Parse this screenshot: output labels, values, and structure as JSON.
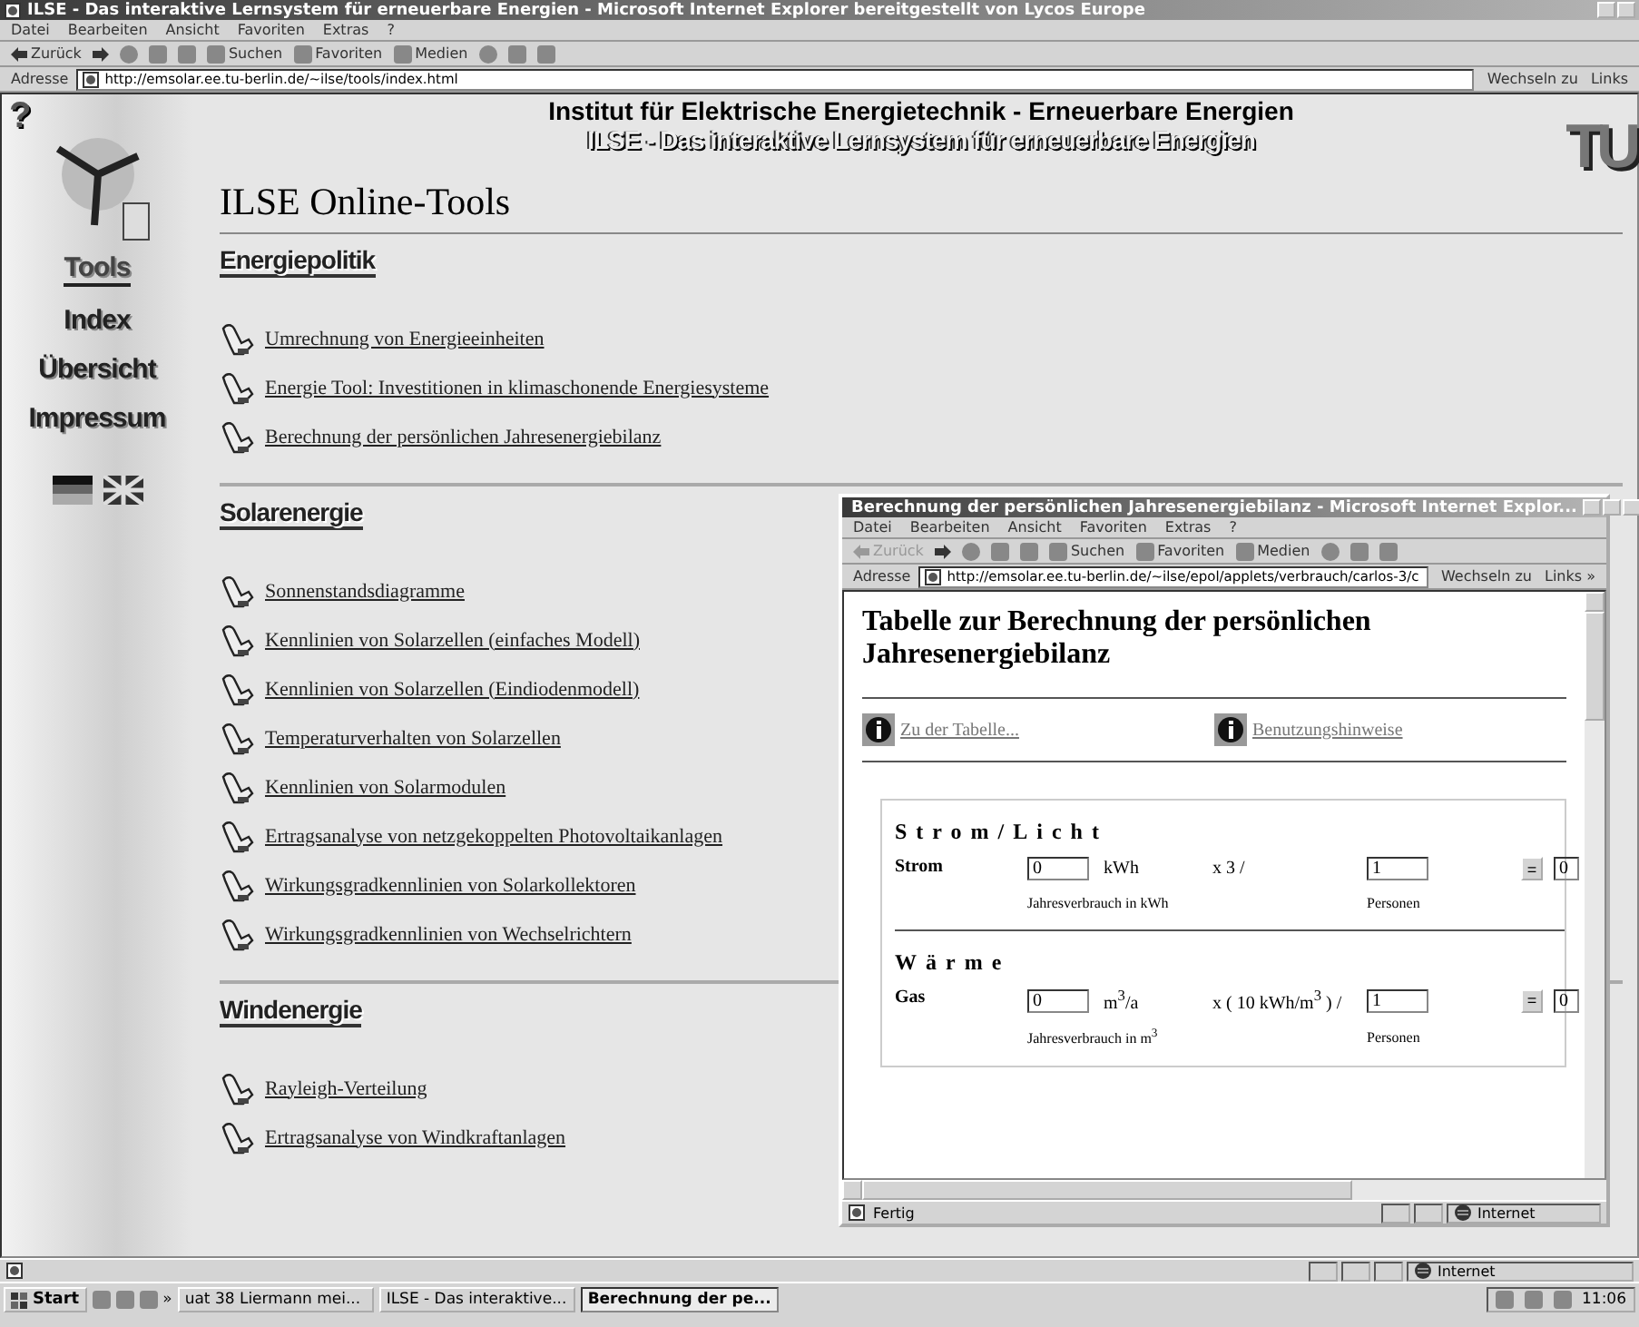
{
  "window": {
    "title": "ILSE - Das interaktive Lernsystem für erneuerbare Energien - Microsoft Internet Explorer bereitgestellt von Lycos Europe",
    "menu": [
      "Datei",
      "Bearbeiten",
      "Ansicht",
      "Favoriten",
      "Extras",
      "?"
    ],
    "toolbar": {
      "back": {
        "label": "Zurück",
        "disabled": false
      },
      "buttons": [
        "Suchen",
        "Favoriten",
        "Medien"
      ]
    },
    "address": {
      "label": "Adresse",
      "value": "http://emsolar.ee.tu-berlin.de/~ilse/tools/index.html"
    },
    "go": "Wechseln zu",
    "links": "Links"
  },
  "page": {
    "help": "?",
    "logo": "TU",
    "header_title": "Institut für Elektrische Energietechnik - Erneuerbare Energien",
    "header_subtitle": "ILSE - Das interaktive Lernsystem für erneuerbare Energien",
    "sidebar": [
      {
        "label": "Tools",
        "selected": true
      },
      {
        "label": "Index",
        "selected": false
      },
      {
        "label": "Übersicht",
        "selected": false
      },
      {
        "label": "Impressum",
        "selected": false
      }
    ],
    "heading": "ILSE Online-Tools",
    "sections": [
      {
        "title": "Energiepolitik",
        "links": [
          "Umrechnung von Energieeinheiten",
          "Energie Tool: Investitionen in klimaschonende Energiesysteme",
          "Berechnung der persönlichen Jahresenergiebilanz"
        ]
      },
      {
        "title": "Solarenergie",
        "links": [
          "Sonnenstandsdiagramme",
          "Kennlinien von Solarzellen (einfaches Modell)",
          "Kennlinien von Solarzellen (Eindiodenmodell)",
          "Temperaturverhalten von Solarzellen",
          "Kennlinien von Solarmodulen",
          "Ertragsanalyse von netzgekoppelten Photovoltaikanlagen",
          "Wirkungsgradkennlinien von Solarkollektoren",
          "Wirkungsgradkennlinien von Wechselrichtern"
        ]
      },
      {
        "title": "Windenergie",
        "links": [
          "Rayleigh-Verteilung",
          "Ertragsanalyse von Windkraftanlagen"
        ]
      }
    ]
  },
  "popup": {
    "title": "Berechnung der persönlichen Jahresenergiebilanz - Microsoft Internet Explor...",
    "menu": [
      "Datei",
      "Bearbeiten",
      "Ansicht",
      "Favoriten",
      "Extras",
      "?"
    ],
    "toolbar": {
      "back": {
        "label": "Zurück",
        "disabled": true
      },
      "buttons": [
        "Suchen",
        "Favoriten",
        "Medien"
      ]
    },
    "address": {
      "label": "Adresse",
      "value": "http://emsolar.ee.tu-berlin.de/~ilse/epol/applets/verbrauch/carlos-3/c"
    },
    "go": "Wechseln zu",
    "links": "Links »",
    "heading": "Tabelle zur Berechnung der persönlichen Jahresenergiebilanz",
    "info_links": [
      "Zu der Tabelle...",
      "Benutzungshinweise"
    ],
    "groups": [
      {
        "title": "Strom/Licht",
        "rows": [
          {
            "label": "Strom",
            "value": "0",
            "unit": "kWh",
            "factor": "x 3 /",
            "persons": "1",
            "equals": "=",
            "result": "0",
            "caption": "Jahresverbrauch in kWh",
            "persons_caption": "Personen"
          }
        ]
      },
      {
        "title": "Wärme",
        "rows": [
          {
            "label": "Gas",
            "value": "0",
            "unit": "m$^{3}$/a",
            "factor": "x ( 10 kWh/m$^{3}$ ) /",
            "persons": "1",
            "equals": "=",
            "result": "0",
            "caption": "Jahresverbrauch in m$^{3}$",
            "persons_caption": "Personen"
          }
        ]
      }
    ],
    "status": "Fertig",
    "zone": "Internet"
  },
  "status_bar": {
    "zone": "Internet"
  },
  "taskbar": {
    "start": "Start",
    "more": "»",
    "tasks": [
      {
        "label": "uat 38 Liermann mei...",
        "selected": false
      },
      {
        "label": "ILSE - Das interaktive...",
        "selected": false
      },
      {
        "label": "Berechnung der pe...",
        "selected": true
      }
    ],
    "clock": "11:06"
  }
}
